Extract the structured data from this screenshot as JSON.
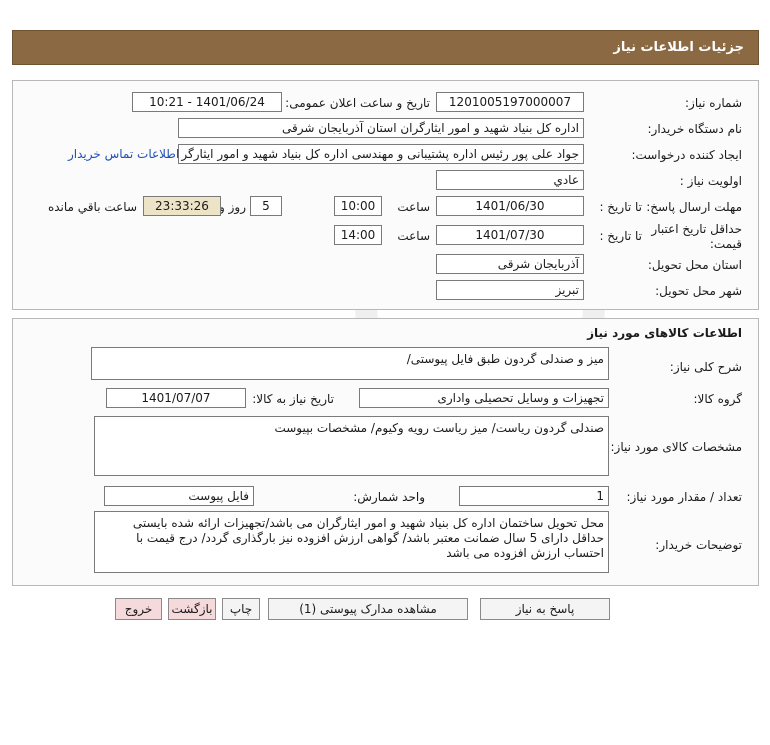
{
  "header": {
    "title": "جزئیات اطلاعات نیاز"
  },
  "details": {
    "need_number_label": "شماره نیاز:",
    "need_number": "1201005197000007",
    "announce_label": "تاریخ و ساعت اعلان عمومی:",
    "announce_value": "1401/06/24 - 10:21",
    "buyer_org_label": "نام دستگاه خریدار:",
    "buyer_org": "اداره کل بنیاد شهید و امور ایثارگران استان آذربایجان شرقی",
    "requester_label": "ایجاد کننده درخواست:",
    "requester": "جواد علی پور رئیس اداره پشتیبانی و مهندسی اداره کل بنیاد شهید و امور ایثارگر",
    "contact_link": "اطلاعات تماس خریدار",
    "priority_label": "اولویت نیاز :",
    "priority": "عادي",
    "deadline_label": "مهلت ارسال پاسخ:",
    "to_date_label": "تا تاریخ :",
    "deadline_date": "1401/06/30",
    "time_label": "ساعت",
    "deadline_time": "10:00",
    "days_value": "5",
    "days_label": "روز و",
    "remaining_time": "23:33:26",
    "remaining_label": "ساعت باقي مانده",
    "price_validity_label": "حداقل تاریخ اعتبار قیمت:",
    "price_validity_date": "1401/07/30",
    "price_validity_time": "14:00",
    "province_label": "استان محل تحویل:",
    "province": "آذربایجان شرقی",
    "city_label": "شهر محل تحویل:",
    "city": "تبریز"
  },
  "goods": {
    "section_title": "اطلاعات کالاهای مورد نیاز",
    "general_desc_label": "شرح کلی نیاز:",
    "general_desc": "میز و صندلی گردون طبق فایل پیوستی/",
    "group_label": "گروه کالا:",
    "group": "تجهیزات و وسایل تحصیلی واداری",
    "need_date_label": "تاریخ نیاز به کالا:",
    "need_date": "1401/07/07",
    "specs_label": "مشخصات کالای مورد نیاز:",
    "specs": "صندلی گردون ریاست/ میز ریاست رویه وکیوم/ مشخصات بپیوست",
    "qty_label": "تعداد / مقدار مورد نیاز:",
    "qty": "1",
    "unit_label": "واحد شمارش:",
    "unit": "فایل پیوست",
    "buyer_notes_label": "توضیحات خریدار:",
    "buyer_notes": "محل تحویل ساختمان اداره کل بنیاد شهید و امور ایثارگران می باشد/تجهیزات ارائه شده بایستی حداقل دارای  5 سال ضمانت معتبر باشد/ گواهی ارزش افزوده نیز بارگذاری گردد/ درج قیمت با احتساب ارزش افزوده می باشد"
  },
  "buttons": {
    "reply": "پاسخ به نیاز",
    "attachments": "مشاهده مدارک پیوستی (1)",
    "print": "چاپ",
    "back": "بازگشت",
    "exit": "خروج"
  }
}
